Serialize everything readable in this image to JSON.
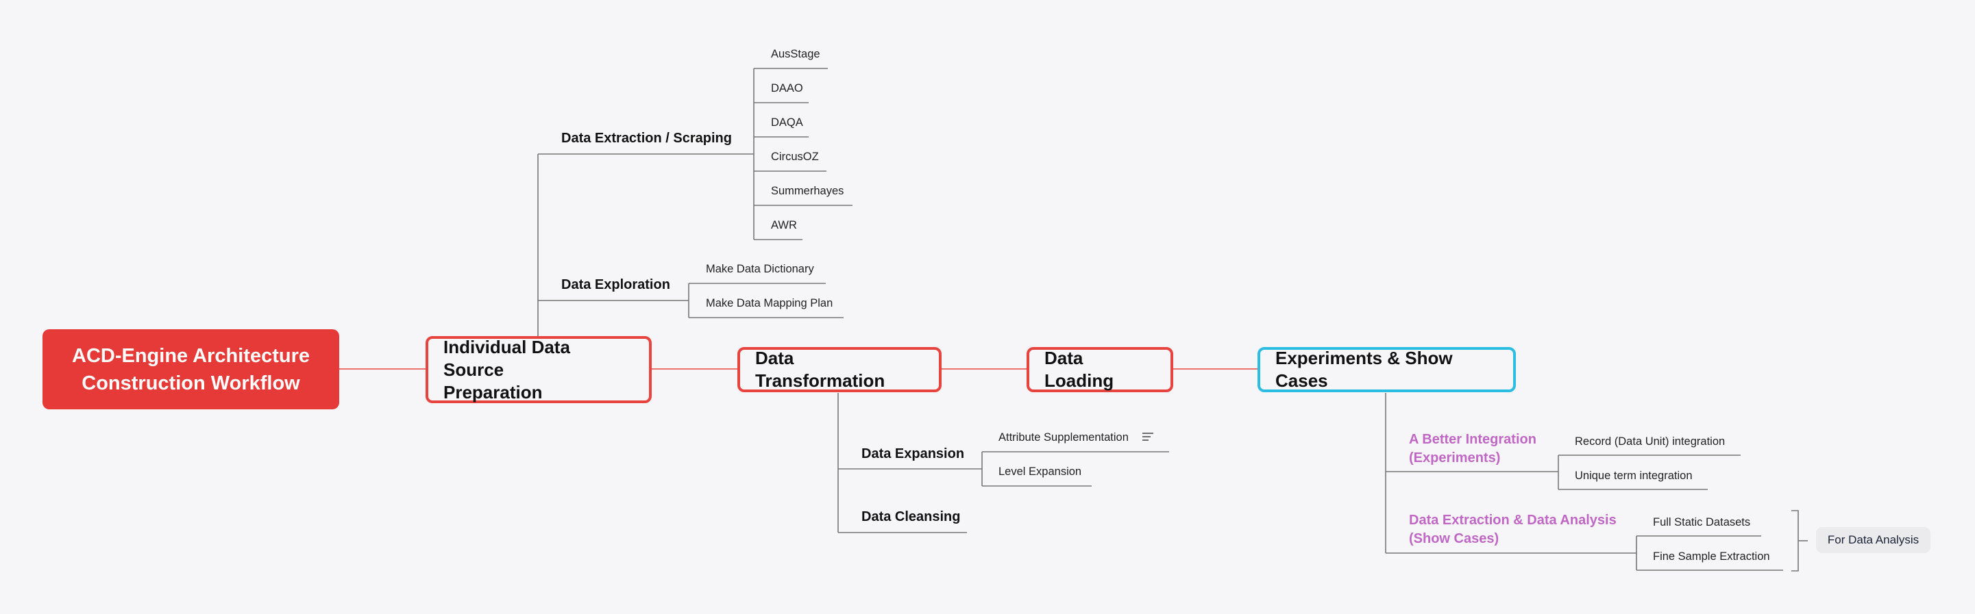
{
  "root": {
    "label_line1": "ACD-Engine Architecture",
    "label_line2": "Construction Workflow"
  },
  "stages": [
    {
      "label_line1": "Individual Data Source",
      "label_line2": "Preparation"
    },
    {
      "label": "Data Transformation"
    },
    {
      "label": "Data Loading"
    },
    {
      "label": "Experiments & Show Cases"
    }
  ],
  "preparation": {
    "extraction": {
      "label": "Data Extraction / Scraping",
      "sources": [
        "AusStage",
        "DAAO",
        "DAQA",
        "CircusOZ",
        "Summerhayes",
        "AWR"
      ]
    },
    "exploration": {
      "label": "Data Exploration",
      "items": [
        "Make Data Dictionary",
        "Make Data Mapping Plan"
      ]
    }
  },
  "transformation": {
    "expansion": {
      "label": "Data Expansion",
      "items": [
        "Attribute Supplementation",
        "Level Expansion"
      ],
      "note_icon": "notes-icon"
    },
    "cleansing": {
      "label": "Data Cleansing"
    }
  },
  "experiments": {
    "integration": {
      "label_line1": "A Better Integration",
      "label_line2": "(Experiments)",
      "items": [
        "Record (Data Unit) integration",
        "Unique term integration"
      ]
    },
    "analysis": {
      "label_line1": "Data Extraction & Data Analysis",
      "label_line2": "(Show Cases)",
      "items": [
        "Full Static Datasets",
        "Fine Sample Extraction"
      ],
      "summary": "For Data Analysis"
    }
  },
  "colors": {
    "root": "#e53a37",
    "stage_border": "#e8443f",
    "experiments_border": "#2cbde2",
    "purple_text": "#c067c5",
    "connector_red": "#e8443f",
    "connector_gray": "#777777"
  }
}
